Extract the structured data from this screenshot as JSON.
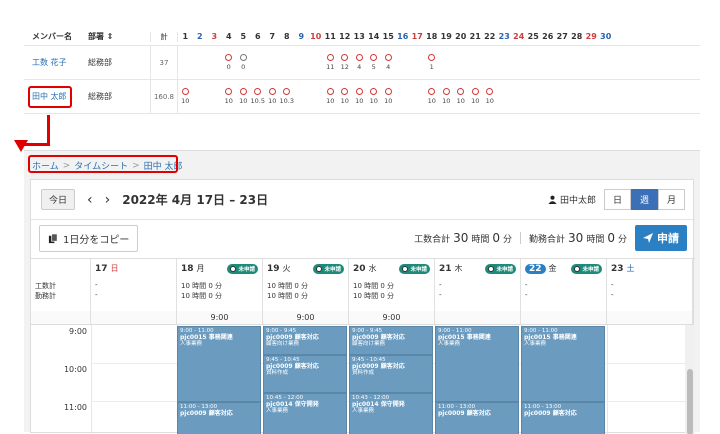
{
  "member_table": {
    "headers": {
      "name": "メンバー名",
      "dept": "部署 ⇕",
      "total": "計"
    },
    "days": [
      "1",
      "2",
      "3",
      "4",
      "5",
      "6",
      "7",
      "8",
      "9",
      "10",
      "11",
      "12",
      "13",
      "14",
      "15",
      "16",
      "17",
      "18",
      "19",
      "20",
      "21",
      "22",
      "23",
      "24",
      "25",
      "26",
      "27",
      "28",
      "29",
      "30"
    ],
    "rows": [
      {
        "name": "工数 花子",
        "dept": "総務部",
        "total": "37",
        "values": {
          "4": "0",
          "5": "0",
          "11": "11",
          "12": "12",
          "13": "4",
          "14": "5",
          "15": "4",
          "18": "1"
        }
      },
      {
        "name": "田中 太郎",
        "dept": "総務部",
        "total": "160.8",
        "values": {
          "1": "10",
          "4": "10",
          "5": "10",
          "6": "10.5",
          "7": "10",
          "8": "10.3",
          "11": "10",
          "12": "10",
          "13": "10",
          "14": "10",
          "15": "10",
          "18": "10",
          "19": "10",
          "20": "10",
          "21": "10",
          "22": "10"
        }
      }
    ]
  },
  "breadcrumb": {
    "home": "ホーム",
    "sep": ">",
    "timesheet": "タイムシート",
    "user": "田中 太郎"
  },
  "nav": {
    "today": "今日",
    "prev": "‹",
    "next": "›",
    "range": "2022年 4月 17日 – 23日",
    "user": "田中太郎",
    "views": [
      "日",
      "週",
      "月"
    ]
  },
  "toolbar": {
    "copy_label": "1日分をコピー",
    "work_total_label": "工数合計",
    "work_total_h": "30",
    "work_total_h_unit": "時間",
    "work_total_m": "0",
    "work_total_m_unit": "分",
    "attend_total_label": "勤務合計",
    "attend_total_h": "30",
    "attend_total_h_unit": "時間",
    "attend_total_m": "0",
    "attend_total_m_unit": "分",
    "apply_label": "申請"
  },
  "calendar": {
    "row_labels": {
      "work": "工数計",
      "attend": "勤務計"
    },
    "columns": [
      {
        "date": "17",
        "dow": "日",
        "status": "",
        "work": "-",
        "attend": "-",
        "allday": ""
      },
      {
        "date": "18",
        "dow": "月",
        "status": "未申請",
        "work": "10 時間 0 分",
        "attend": "10 時間 0 分",
        "allday": "9:00"
      },
      {
        "date": "19",
        "dow": "火",
        "status": "未申請",
        "work": "10 時間 0 分",
        "attend": "10 時間 0 分",
        "allday": "9:00"
      },
      {
        "date": "20",
        "dow": "水",
        "status": "未申請",
        "work": "10 時間 0 分",
        "attend": "10 時間 0 分",
        "allday": "9:00"
      },
      {
        "date": "21",
        "dow": "木",
        "status": "未申請",
        "work": "-",
        "attend": "-",
        "allday": ""
      },
      {
        "date": "22",
        "dow": "金",
        "status": "未申請",
        "work": "-",
        "attend": "-",
        "allday": ""
      },
      {
        "date": "23",
        "dow": "土",
        "status": "",
        "work": "-",
        "attend": "-",
        "allday": ""
      }
    ],
    "times": [
      "9:00",
      "10:00",
      "11:00"
    ],
    "events": {
      "mon_a": {
        "time": "9:00 - 11:00",
        "title": "pjc0015 事務関連",
        "sub": "人事業務"
      },
      "tue_a": {
        "time": "9:00 - 9:45",
        "title": "pjc0009 顧客対応",
        "sub": "顧客向け業務"
      },
      "tue_b": {
        "time": "9:45 - 10:45",
        "title": "pjc0009 顧客対応",
        "sub": "資料作成"
      },
      "tue_c": {
        "time": "10:45 - 12:00",
        "title": "pjc0014 保守開発",
        "sub": "人事業務"
      },
      "wed_a": {
        "time": "9:00 - 9:45",
        "title": "pjc0009 顧客対応",
        "sub": "顧客向け業務"
      },
      "wed_b": {
        "time": "9:45 - 10:45",
        "title": "pjc0009 顧客対応",
        "sub": "資料作成"
      },
      "wed_c": {
        "time": "10:43 - 12:00",
        "title": "pjc0014 保守開発",
        "sub": "人事業務"
      },
      "thu_a": {
        "time": "9:00 - 11:00",
        "title": "pjc0015 事務関連",
        "sub": "人事業務"
      },
      "fri_a": {
        "time": "9:00 - 11:00",
        "title": "pjc0015 事務関連",
        "sub": "人事業務"
      },
      "mon_b": {
        "time": "11:00 - 13:00",
        "title": "pjc0009 顧客対応",
        "sub": ""
      },
      "thu_b": {
        "time": "11:00 - 13:00",
        "title": "pjc0009 顧客対応",
        "sub": ""
      },
      "fri_b": {
        "time": "11:00 - 13:00",
        "title": "pjc0009 顧客対応",
        "sub": ""
      }
    }
  },
  "colors": {
    "accent": "#2b7fc3",
    "event": "#6b9bbf",
    "highlight": "#e00000",
    "status": "#1e8a7a"
  }
}
